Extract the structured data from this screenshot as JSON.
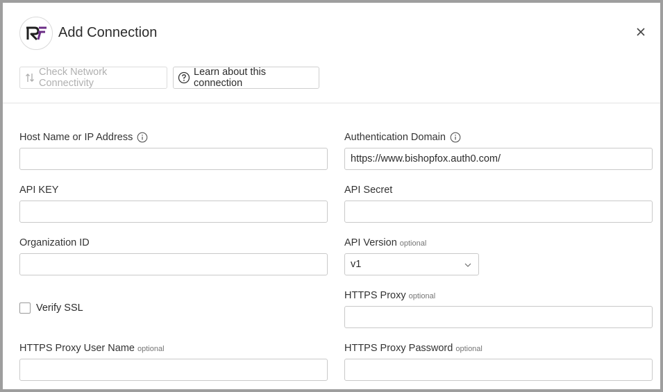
{
  "dialog": {
    "title": "Add Connection",
    "close_icon": "close-icon",
    "logo_icon": "brand-logo-icon"
  },
  "toolbar": {
    "check_network_label": "Check Network Connectivity",
    "check_network_icon": "network-test-icon",
    "learn_label": "Learn about this connection",
    "learn_icon": "help-circle-icon"
  },
  "form": {
    "host": {
      "label": "Host Name or IP Address",
      "value": ""
    },
    "auth_domain": {
      "label": "Authentication Domain",
      "value": "https://www.bishopfox.auth0.com/"
    },
    "api_key": {
      "label": "API KEY",
      "value": ""
    },
    "api_secret": {
      "label": "API Secret",
      "value": ""
    },
    "org_id": {
      "label": "Organization ID",
      "value": ""
    },
    "api_version": {
      "label": "API Version",
      "optional": "optional",
      "value": "v1"
    },
    "verify_ssl": {
      "label": "Verify SSL",
      "checked": false
    },
    "https_proxy": {
      "label": "HTTPS Proxy",
      "optional": "optional",
      "value": ""
    },
    "proxy_user": {
      "label": "HTTPS Proxy User Name",
      "optional": "optional",
      "value": ""
    },
    "proxy_password": {
      "label": "HTTPS Proxy Password",
      "optional": "optional",
      "value": ""
    }
  },
  "colors": {
    "brand_purple": "#6b2d86",
    "brand_dark": "#1f1f1f"
  }
}
